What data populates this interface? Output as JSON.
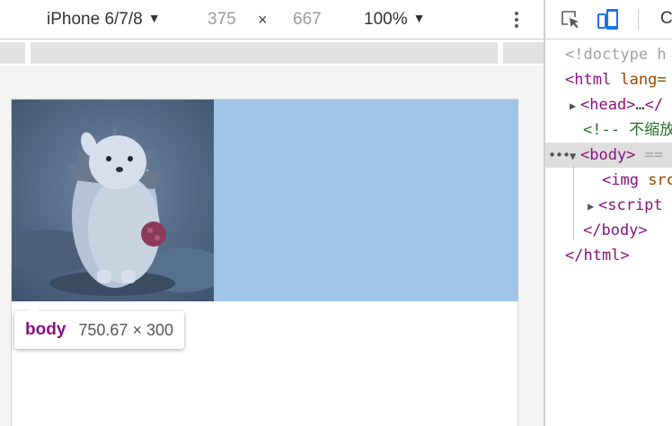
{
  "device_toolbar": {
    "device_name": "iPhone 6/7/8",
    "width": "375",
    "times": "×",
    "height": "667",
    "zoom": "100%",
    "dropdown_caret": "▼",
    "more_icon": "vertical-dots-icon"
  },
  "tooltip": {
    "tag": "body",
    "size": "750.67 × 300"
  },
  "colors": {
    "highlight": "#9fc4e8",
    "tag": "#881280",
    "attribute": "#994500",
    "comment": "#236e25"
  },
  "devtools_toolbar": {
    "inspect_icon": "inspect-element-icon",
    "device_icon": "device-toolbar-icon",
    "console_tab_partial": "C"
  },
  "dom_tree": {
    "doctype": "<!doctype h",
    "html_open_tag": "<html",
    "html_attr": " lang=",
    "head_open": "<head>",
    "head_ellipsis": "…",
    "head_close_partial": "</",
    "comment": "<!-- 不缩放",
    "body_open": "<body>",
    "body_equals": " ==",
    "selected_dots": "•••",
    "img_open": "<img",
    "img_attr": " src",
    "script_open": "<script",
    "body_close": "</body>",
    "html_close": "</html>",
    "triangle_right": "▶",
    "triangle_down": "▼"
  }
}
